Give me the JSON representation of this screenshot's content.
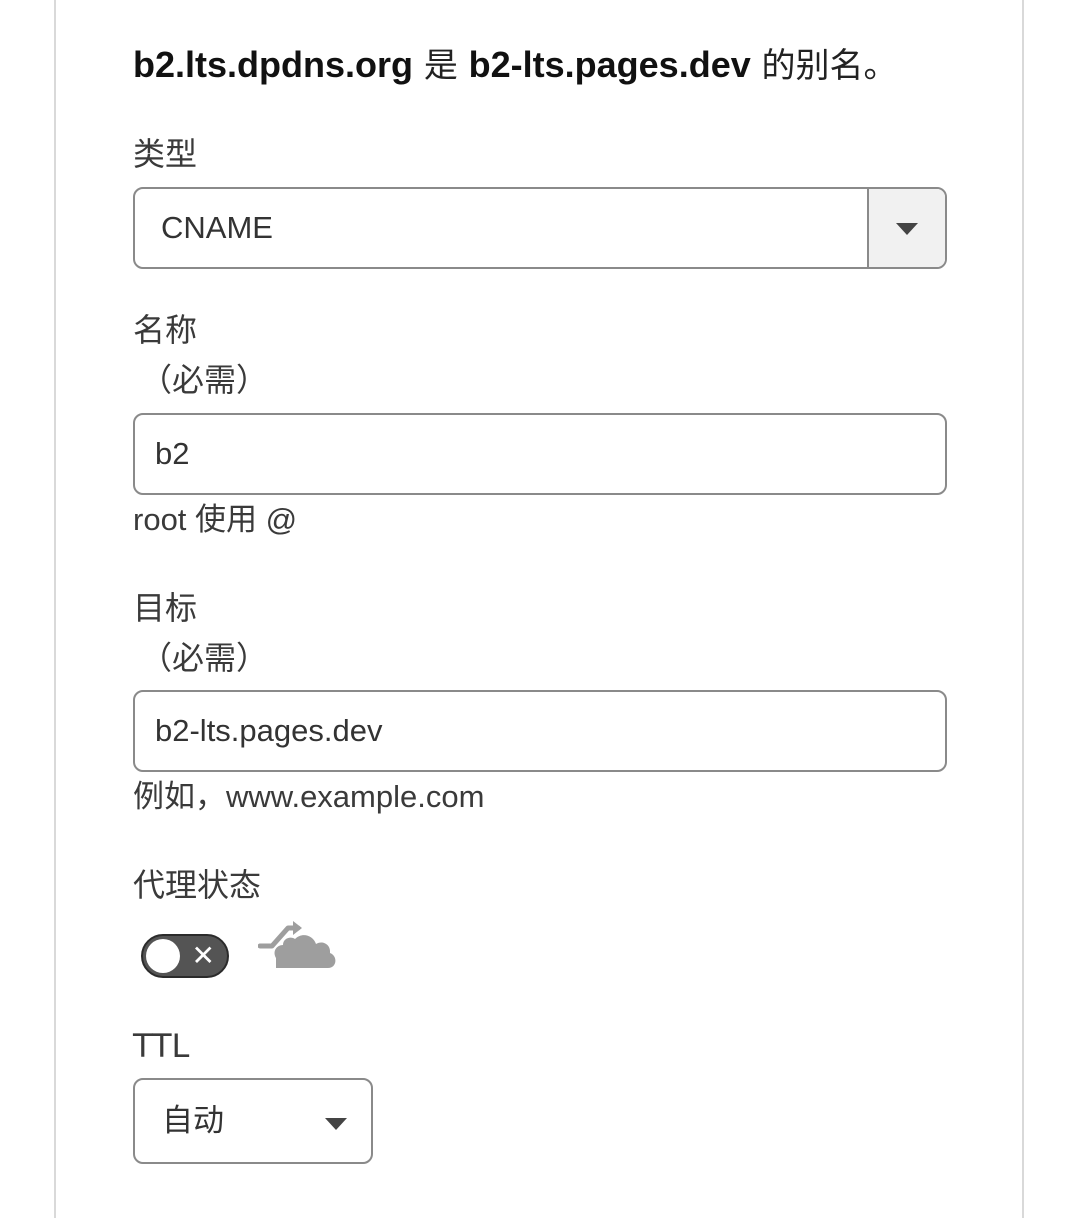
{
  "summary": {
    "alias_name": "b2.lts.dpdns.org",
    "connector": " 是 ",
    "target_name": "b2-lts.pages.dev",
    "suffix": " 的别名。"
  },
  "type_field": {
    "label": "类型",
    "value": "CNAME"
  },
  "name_field": {
    "label": "名称",
    "required": "（必需）",
    "value": "b2",
    "hint": "root 使用 @"
  },
  "target_field": {
    "label": "目标",
    "required": "（必需）",
    "value": "b2-lts.pages.dev",
    "hint": "例如，www.example.com"
  },
  "proxy": {
    "label": "代理状态",
    "toggle_on": false,
    "toggle_off_glyph": "✕",
    "status_icon": "dns-only-cloud-icon"
  },
  "ttl_field": {
    "label": "TTL",
    "value": "自动"
  },
  "colors": {
    "border": "#8a8a8a",
    "toggle_off": "#545454",
    "cloud_gray": "#9e9e9e"
  }
}
